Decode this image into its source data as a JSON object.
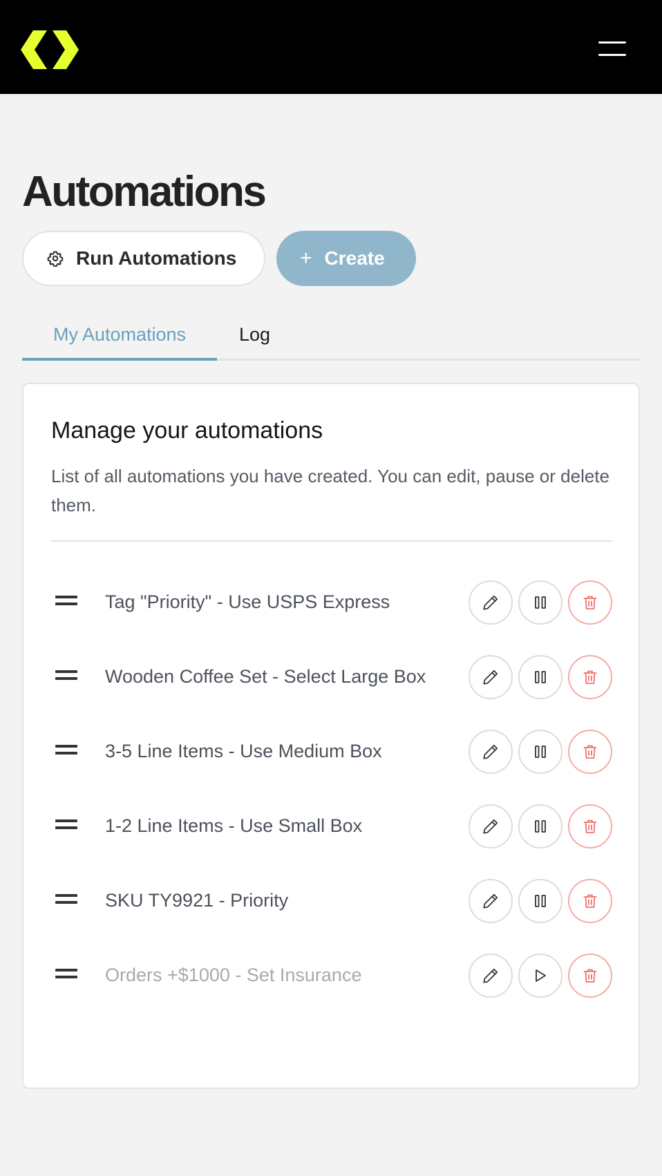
{
  "header": {
    "logo_icon": "brand-chevron-logo",
    "menu_icon": "hamburger-menu-icon",
    "background": "#000000",
    "logo_color": "#e6ff2e"
  },
  "page": {
    "title": "Automations",
    "run_button_label": "Run Automations",
    "run_button_icon": "gear-icon",
    "create_button_label": "Create",
    "create_button_icon": "plus-icon",
    "accent_color": "#6b9fbc"
  },
  "tabs": [
    {
      "label": "My Automations",
      "active": true
    },
    {
      "label": "Log",
      "active": false
    }
  ],
  "card": {
    "title": "Manage your automations",
    "description": "List of all automations you have created. You can edit, pause or delete them."
  },
  "automations": [
    {
      "name": "Tag \"Priority\" - Use USPS Express",
      "status": "active",
      "toggle_icon": "pause-icon"
    },
    {
      "name": "Wooden Coffee Set - Select Large Box",
      "status": "active",
      "toggle_icon": "pause-icon"
    },
    {
      "name": "3-5 Line Items - Use Medium Box",
      "status": "active",
      "toggle_icon": "pause-icon"
    },
    {
      "name": "1-2 Line Items - Use Small Box",
      "status": "active",
      "toggle_icon": "pause-icon"
    },
    {
      "name": "SKU TY9921 - Priority",
      "status": "active",
      "toggle_icon": "pause-icon"
    },
    {
      "name": "Orders +$1000 - Set Insurance",
      "status": "paused",
      "toggle_icon": "play-icon"
    }
  ],
  "row_actions": {
    "edit_icon": "pencil-icon",
    "delete_icon": "trash-icon",
    "delete_color": "#f0706b"
  }
}
